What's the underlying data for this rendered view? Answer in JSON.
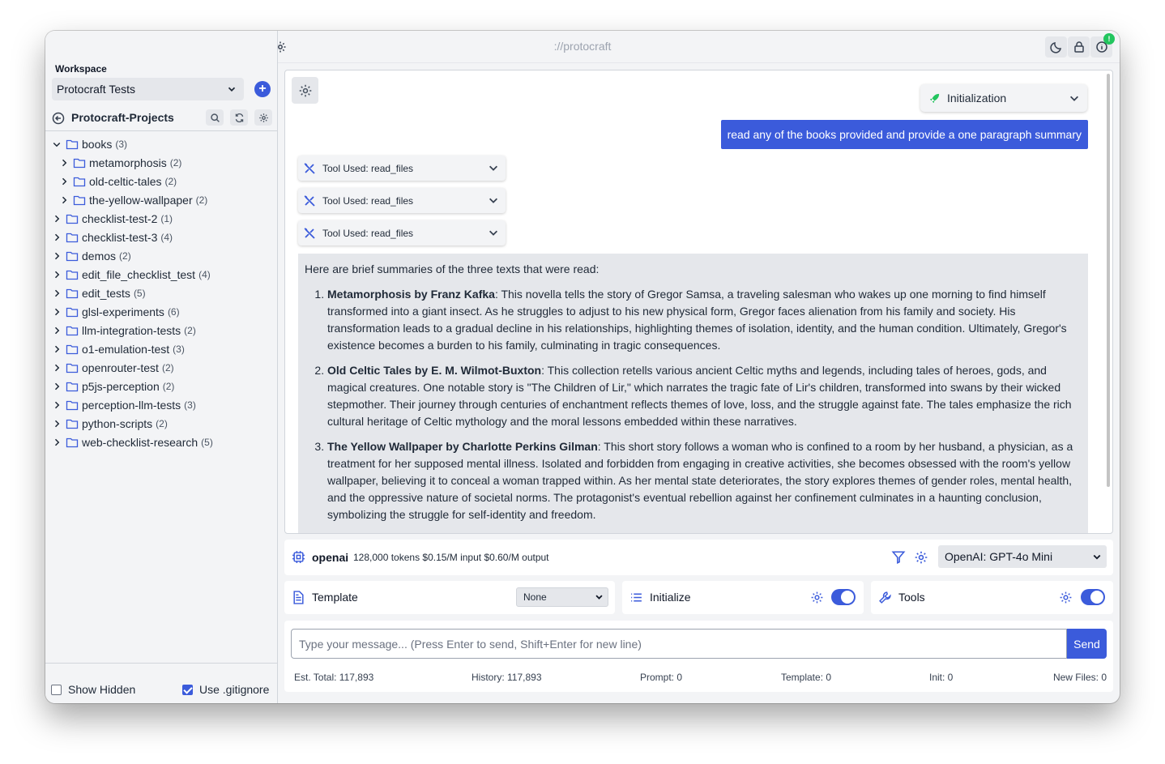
{
  "app": {
    "title": "://protocraft"
  },
  "colors": {
    "accent": "#3b5bdb",
    "bg": "#f3f4f6",
    "reply_bg": "#e5e7eb",
    "badge": "#22c55e"
  },
  "toolbar": {
    "badge": "!"
  },
  "workspace": {
    "label": "Workspace",
    "selected": "Protocraft Tests",
    "add_label": "+"
  },
  "project": {
    "title": "Protocraft-Projects"
  },
  "tree": [
    {
      "name": "books",
      "count": "(3)",
      "level": 0,
      "expanded": true
    },
    {
      "name": "metamorphosis",
      "count": "(2)",
      "level": 1,
      "expanded": false
    },
    {
      "name": "old-celtic-tales",
      "count": "(2)",
      "level": 1,
      "expanded": false
    },
    {
      "name": "the-yellow-wallpaper",
      "count": "(2)",
      "level": 1,
      "expanded": false
    },
    {
      "name": "checklist-test-2",
      "count": "(1)",
      "level": 0,
      "expanded": false
    },
    {
      "name": "checklist-test-3",
      "count": "(4)",
      "level": 0,
      "expanded": false
    },
    {
      "name": "demos",
      "count": "(2)",
      "level": 0,
      "expanded": false
    },
    {
      "name": "edit_file_checklist_test",
      "count": "(4)",
      "level": 0,
      "expanded": false
    },
    {
      "name": "edit_tests",
      "count": "(5)",
      "level": 0,
      "expanded": false
    },
    {
      "name": "glsl-experiments",
      "count": "(6)",
      "level": 0,
      "expanded": false
    },
    {
      "name": "llm-integration-tests",
      "count": "(2)",
      "level": 0,
      "expanded": false
    },
    {
      "name": "o1-emulation-test",
      "count": "(3)",
      "level": 0,
      "expanded": false
    },
    {
      "name": "openrouter-test",
      "count": "(2)",
      "level": 0,
      "expanded": false
    },
    {
      "name": "p5js-perception",
      "count": "(2)",
      "level": 0,
      "expanded": false
    },
    {
      "name": "perception-llm-tests",
      "count": "(3)",
      "level": 0,
      "expanded": false
    },
    {
      "name": "python-scripts",
      "count": "(2)",
      "level": 0,
      "expanded": false
    },
    {
      "name": "web-checklist-research",
      "count": "(5)",
      "level": 0,
      "expanded": false
    }
  ],
  "sidebar_footer": {
    "show_hidden": "Show Hidden",
    "show_hidden_checked": false,
    "use_gitignore": "Use .gitignore",
    "use_gitignore_checked": true
  },
  "chat": {
    "mode_dropdown": "Initialization",
    "user_message": "read any of the books provided and provide a one paragraph summary",
    "tools_used": [
      "Tool Used: read_files",
      "Tool Used: read_files",
      "Tool Used: read_files"
    ],
    "reply": {
      "intro": "Here are brief summaries of the three texts that were read:",
      "items": [
        {
          "title": "Metamorphosis by Franz Kafka",
          "text": ": This novella tells the story of Gregor Samsa, a traveling salesman who wakes up one morning to find himself transformed into a giant insect. As he struggles to adjust to his new physical form, Gregor faces alienation from his family and society. His transformation leads to a gradual decline in his relationships, highlighting themes of isolation, identity, and the human condition. Ultimately, Gregor's existence becomes a burden to his family, culminating in tragic consequences."
        },
        {
          "title": "Old Celtic Tales by E. M. Wilmot-Buxton",
          "text": ": This collection retells various ancient Celtic myths and legends, including tales of heroes, gods, and magical creatures. One notable story is \"The Children of Lir,\" which narrates the tragic fate of Lir's children, transformed into swans by their wicked stepmother. Their journey through centuries of enchantment reflects themes of love, loss, and the struggle against fate. The tales emphasize the rich cultural heritage of Celtic mythology and the moral lessons embedded within these narratives."
        },
        {
          "title": "The Yellow Wallpaper by Charlotte Perkins Gilman",
          "text": ": This short story follows a woman who is confined to a room by her husband, a physician, as a treatment for her supposed mental illness. Isolated and forbidden from engaging in creative activities, she becomes obsessed with the room's yellow wallpaper, believing it to conceal a woman trapped within. As her mental state deteriorates, the story explores themes of gender roles, mental health, and the oppressive nature of societal norms. The protagonist's eventual rebellion against her confinement culminates in a haunting conclusion, symbolizing the struggle for self-identity and freedom."
        }
      ]
    }
  },
  "model": {
    "provider": "openai",
    "stats": "128,000 tokens  $0.15/M input  $0.60/M output",
    "selected": "OpenAI: GPT-4o Mini"
  },
  "panels": {
    "template": {
      "label": "Template",
      "value": "None"
    },
    "initialize": {
      "label": "Initialize",
      "enabled": true
    },
    "tools": {
      "label": "Tools",
      "enabled": true
    }
  },
  "composer": {
    "placeholder": "Type your message... (Press Enter to send, Shift+Enter for new line)",
    "send_label": "Send"
  },
  "estimates": {
    "total": "Est. Total: 117,893",
    "history": "History: 117,893",
    "prompt": "Prompt: 0",
    "template": "Template: 0",
    "init": "Init: 0",
    "new_files": "New Files: 0"
  }
}
